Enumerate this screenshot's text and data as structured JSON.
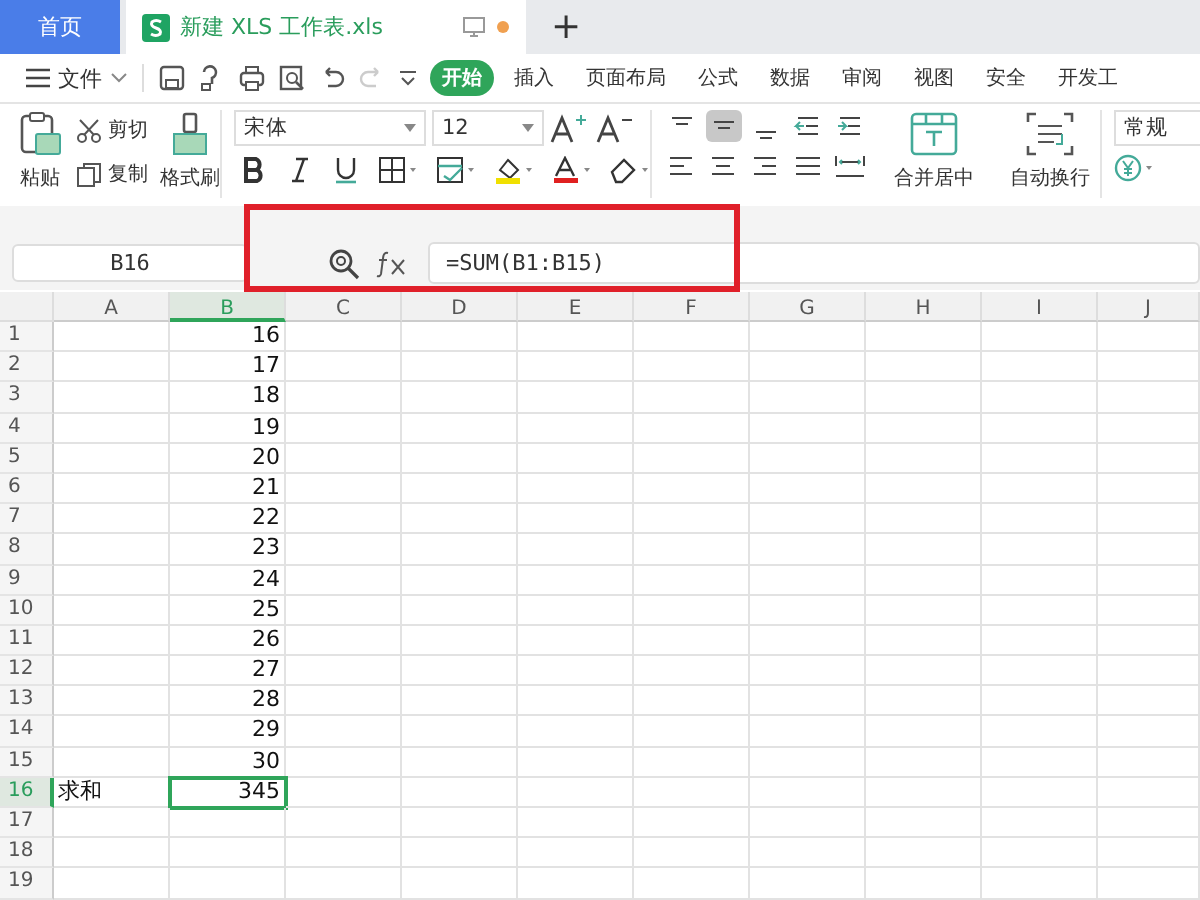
{
  "tabs": [
    {
      "label": "首页",
      "kind": "home",
      "selected": false
    },
    {
      "label": "新建 XLS 工作表.xls",
      "kind": "doc",
      "selected": true
    }
  ],
  "new_tab": "+",
  "menu": {
    "file": "文件",
    "items": [
      {
        "label": "开始",
        "selected": true
      },
      {
        "label": "插入",
        "selected": false
      },
      {
        "label": "页面布局",
        "selected": false
      },
      {
        "label": "公式",
        "selected": false
      },
      {
        "label": "数据",
        "selected": false
      },
      {
        "label": "审阅",
        "selected": false
      },
      {
        "label": "视图",
        "selected": false
      },
      {
        "label": "安全",
        "selected": false
      },
      {
        "label": "开发工",
        "selected": false
      }
    ]
  },
  "ribbon": {
    "paste": "粘贴",
    "cut": "剪切",
    "copy": "复制",
    "format_painter": "格式刷",
    "font": "宋体",
    "font_size": "12",
    "merge": "合并居中",
    "wrap": "自动换行",
    "number_format": "常规"
  },
  "formula_bar": {
    "cell_ref": "B16",
    "formula": "=SUM(B1:B15)"
  },
  "sheet": {
    "columns": [
      {
        "label": "A",
        "selected": false
      },
      {
        "label": "B",
        "selected": true
      },
      {
        "label": "C",
        "selected": false
      },
      {
        "label": "D",
        "selected": false
      },
      {
        "label": "E",
        "selected": false
      },
      {
        "label": "F",
        "selected": false
      },
      {
        "label": "G",
        "selected": false
      },
      {
        "label": "H",
        "selected": false
      },
      {
        "label": "I",
        "selected": false
      },
      {
        "label": "J",
        "selected": false
      }
    ],
    "rows": [
      {
        "label": "1",
        "selected": false,
        "cells": [
          {
            "selected": false
          },
          {
            "text": "16",
            "selected": false
          }
        ]
      },
      {
        "label": "2",
        "selected": false,
        "cells": [
          {
            "selected": false
          },
          {
            "text": "17",
            "selected": false
          }
        ]
      },
      {
        "label": "3",
        "selected": false,
        "cells": [
          {
            "selected": false
          },
          {
            "text": "18",
            "selected": false
          }
        ]
      },
      {
        "label": "4",
        "selected": false,
        "cells": [
          {
            "selected": false
          },
          {
            "text": "19",
            "selected": false
          }
        ]
      },
      {
        "label": "5",
        "selected": false,
        "cells": [
          {
            "selected": false
          },
          {
            "text": "20",
            "selected": false
          }
        ]
      },
      {
        "label": "6",
        "selected": false,
        "cells": [
          {
            "selected": false
          },
          {
            "text": "21",
            "selected": false
          }
        ]
      },
      {
        "label": "7",
        "selected": false,
        "cells": [
          {
            "selected": false
          },
          {
            "text": "22",
            "selected": false
          }
        ]
      },
      {
        "label": "8",
        "selected": false,
        "cells": [
          {
            "selected": false
          },
          {
            "text": "23",
            "selected": false
          }
        ]
      },
      {
        "label": "9",
        "selected": false,
        "cells": [
          {
            "selected": false
          },
          {
            "text": "24",
            "selected": false
          }
        ]
      },
      {
        "label": "10",
        "selected": false,
        "cells": [
          {
            "selected": false
          },
          {
            "text": "25",
            "selected": false
          }
        ]
      },
      {
        "label": "11",
        "selected": false,
        "cells": [
          {
            "selected": false
          },
          {
            "text": "26",
            "selected": false
          }
        ]
      },
      {
        "label": "12",
        "selected": false,
        "cells": [
          {
            "selected": false
          },
          {
            "text": "27",
            "selected": false
          }
        ]
      },
      {
        "label": "13",
        "selected": false,
        "cells": [
          {
            "selected": false
          },
          {
            "text": "28",
            "selected": false
          }
        ]
      },
      {
        "label": "14",
        "selected": false,
        "cells": [
          {
            "selected": false
          },
          {
            "text": "29",
            "selected": false
          }
        ]
      },
      {
        "label": "15",
        "selected": false,
        "cells": [
          {
            "selected": false
          },
          {
            "text": "30",
            "selected": false
          }
        ]
      },
      {
        "label": "16",
        "selected": true,
        "cells": [
          {
            "text": "求和",
            "selected": false
          },
          {
            "text": "345",
            "selected": true
          }
        ]
      },
      {
        "label": "17",
        "selected": false
      },
      {
        "label": "18",
        "selected": false
      },
      {
        "label": "19",
        "selected": false
      }
    ]
  }
}
